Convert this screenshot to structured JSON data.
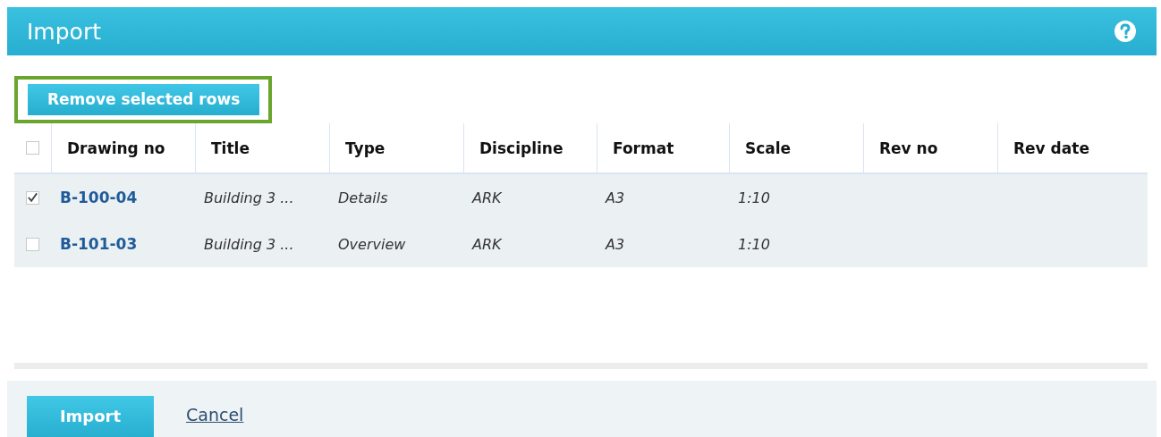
{
  "window": {
    "title": "Import"
  },
  "toolbar": {
    "remove_button": {
      "label": "Remove selected rows",
      "highlighted": true
    }
  },
  "table": {
    "select_all": {
      "checked": false
    },
    "columns": [
      "Drawing no",
      "Title",
      "Type",
      "Discipline",
      "Format",
      "Scale",
      "Rev no",
      "Rev date"
    ],
    "rows": [
      {
        "checked": true,
        "cells": [
          "B-100-04",
          "Building 3 ...",
          "Details",
          "ARK",
          "A3",
          "1:10",
          "",
          ""
        ]
      },
      {
        "checked": false,
        "cells": [
          "B-101-03",
          "Building 3 ...",
          "Overview",
          "ARK",
          "A3",
          "1:10",
          "",
          ""
        ]
      }
    ]
  },
  "footer": {
    "import_button": "Import",
    "cancel_link": "Cancel"
  }
}
